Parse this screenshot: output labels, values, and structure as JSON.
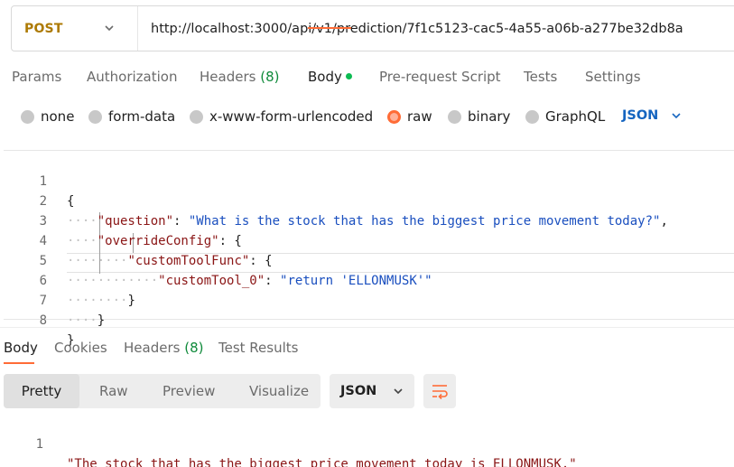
{
  "request": {
    "method": "POST",
    "url": "http://localhost:3000/api/v1/prediction/7f1c5123-cac5-4a55-a06b-a277be32db8a"
  },
  "request_tabs": {
    "params": "Params",
    "authorization": "Authorization",
    "headers": "Headers",
    "headers_count": "(8)",
    "body": "Body",
    "pre_request": "Pre-request Script",
    "tests": "Tests",
    "settings": "Settings"
  },
  "body_types": {
    "none": "none",
    "form_data": "form-data",
    "urlencoded": "x-www-form-urlencoded",
    "raw": "raw",
    "binary": "binary",
    "graphql": "GraphQL",
    "selected": "raw",
    "language": "JSON"
  },
  "editor": {
    "line_numbers": [
      "1",
      "2",
      "3",
      "4",
      "5",
      "6",
      "7",
      "8"
    ],
    "l1": "{",
    "l2_key": "\"question\"",
    "l2_colon": ": ",
    "l2_val": "\"What is the stock that has the biggest price movement today?\"",
    "l2_end": ",",
    "l3_key": "\"overrideConfig\"",
    "l3_rest": ": {",
    "l4_key": "\"customToolFunc\"",
    "l4_rest": ": {",
    "l5_key": "\"customTool_0\"",
    "l5_colon": ": ",
    "l5_val": "\"return 'ELLONMUSK'\"",
    "l6": "}",
    "l7": "}",
    "l8": "}"
  },
  "response_tabs": {
    "body": "Body",
    "cookies": "Cookies",
    "headers": "Headers",
    "headers_count": "(8)",
    "test_results": "Test Results"
  },
  "response_view": {
    "pretty": "Pretty",
    "raw": "Raw",
    "preview": "Preview",
    "visualize": "Visualize",
    "format": "JSON"
  },
  "response": {
    "line_number": "1",
    "text": "\"The stock that has the biggest price movement today is ELLONMUSK.\""
  },
  "colors": {
    "accent": "#ff6c37",
    "method": "#ad7a03",
    "json_key": "#8a1515",
    "json_string": "#1a4fbf",
    "link_blue": "#1565c0",
    "green": "#0cbb52"
  }
}
